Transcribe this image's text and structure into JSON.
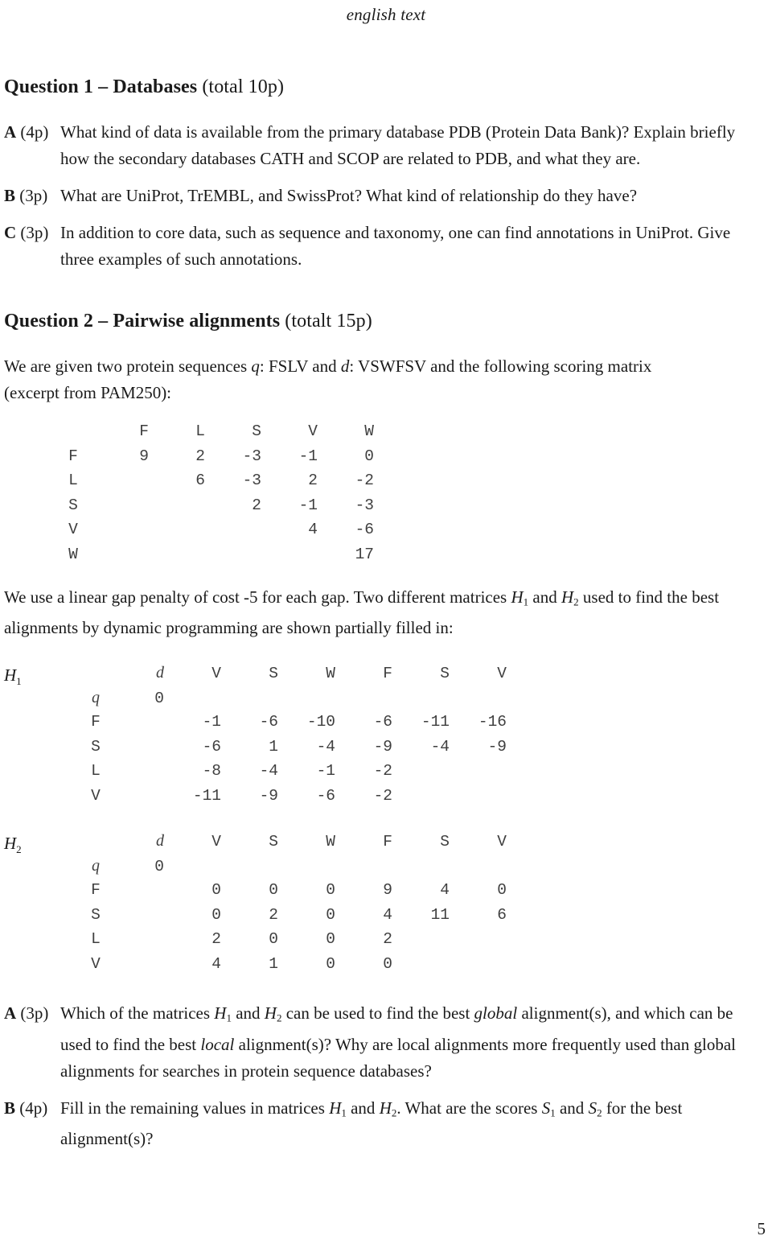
{
  "header": {
    "running_head": "english text"
  },
  "page_number": "5",
  "question1": {
    "heading_bold": "Question 1 – Databases",
    "heading_light": " (total 10p)",
    "items": [
      {
        "letter": "A",
        "points": "(4p)",
        "text": "What kind of data is available from the primary database PDB (Protein Data Bank)? Explain briefly how the secondary databases CATH and SCOP are related to PDB, and what they are."
      },
      {
        "letter": "B",
        "points": "(3p)",
        "text": "What are UniProt, TrEMBL, and SwissProt? What kind of relationship do they have?"
      },
      {
        "letter": "C",
        "points": "(3p)",
        "text": "In addition to core data, such as sequence and taxonomy, one can find annotations in UniProt. Give three examples of such annotations."
      }
    ]
  },
  "question2": {
    "heading_bold": "Question 2 – Pairwise alignments",
    "heading_light": " (totalt 15p)",
    "intro_line1_a": "We are given two protein sequences ",
    "intro_q": "q",
    "intro_line1_b": ": FSLV and ",
    "intro_d": "d",
    "intro_line1_c": ": VSWFSV and the following scoring matrix",
    "intro_line2": "(excerpt from PAM250):",
    "gap_note_a": "We use a linear gap penalty of cost -5 for each gap. Two different matrices ",
    "gap_note_h1": "H",
    "gap_note_h1sub": "1",
    "gap_note_b": " and ",
    "gap_note_h2": "H",
    "gap_note_h2sub": "2",
    "gap_note_c": " used to find the best alignments by dynamic programming are shown partially filled in:",
    "items": [
      {
        "letter": "A",
        "points": "(3p)",
        "text_a": "Which of the matrices ",
        "h1": "H",
        "h1sub": "1",
        "text_b": " and ",
        "h2": "H",
        "h2sub": "2",
        "text_c": " can be used to find the best ",
        "em1": "global",
        "text_d": " alignment(s), and which can be used to find the best ",
        "em2": "local",
        "text_e": " alignment(s)? Why are local alignments more frequently used than global alignments for searches in protein sequence databases?"
      },
      {
        "letter": "B",
        "points": "(4p)",
        "text_a": "Fill in the remaining values in matrices ",
        "h1": "H",
        "h1sub": "1",
        "text_b": " and ",
        "h2": "H",
        "h2sub": "2",
        "text_c": ". What are the scores ",
        "s1": "S",
        "s1sub": "1",
        "text_d": " and ",
        "s2": "S",
        "s2sub": "2",
        "text_e": " for the best alignment(s)?"
      }
    ]
  },
  "chart_data": {
    "type": "table",
    "title": "Scoring matrix excerpt from PAM250 and dynamic programming matrices H1, H2",
    "scoring_matrix": {
      "name": "PAM250 excerpt",
      "columns": [
        "F",
        "L",
        "S",
        "V",
        "W"
      ],
      "rows": [
        {
          "label": "F",
          "values": [
            "9",
            "2",
            "-3",
            "-1",
            "0"
          ]
        },
        {
          "label": "L",
          "values": [
            "",
            "6",
            "-3",
            "2",
            "-2"
          ]
        },
        {
          "label": "S",
          "values": [
            "",
            "",
            "2",
            "-1",
            "-3"
          ]
        },
        {
          "label": "V",
          "values": [
            "",
            "",
            "",
            "4",
            "-6"
          ]
        },
        {
          "label": "W",
          "values": [
            "",
            "",
            "",
            "",
            "17"
          ]
        }
      ]
    },
    "h1": {
      "name": "H",
      "sub": "1",
      "corner_d": "d",
      "columns": [
        "V",
        "S",
        "W",
        "F",
        "S",
        "V"
      ],
      "rows": [
        {
          "label": "q",
          "italic": true,
          "origin": "0",
          "values": [
            "",
            "",
            "",
            "",
            "",
            ""
          ]
        },
        {
          "label": "F",
          "origin": "",
          "values": [
            "-1",
            "-6",
            "-10",
            "-6",
            "-11",
            "-16"
          ]
        },
        {
          "label": "S",
          "origin": "",
          "values": [
            "-6",
            "1",
            "-4",
            "-9",
            "-4",
            "-9"
          ]
        },
        {
          "label": "L",
          "origin": "",
          "values": [
            "-8",
            "-4",
            "-1",
            "-2",
            "",
            ""
          ]
        },
        {
          "label": "V",
          "origin": "",
          "values": [
            "-11",
            "-9",
            "-6",
            "-2",
            "",
            ""
          ]
        }
      ]
    },
    "h2": {
      "name": "H",
      "sub": "2",
      "corner_d": "d",
      "columns": [
        "V",
        "S",
        "W",
        "F",
        "S",
        "V"
      ],
      "rows": [
        {
          "label": "q",
          "italic": true,
          "origin": "0",
          "values": [
            "",
            "",
            "",
            "",
            "",
            ""
          ]
        },
        {
          "label": "F",
          "origin": "",
          "values": [
            "0",
            "0",
            "0",
            "9",
            "4",
            "0"
          ]
        },
        {
          "label": "S",
          "origin": "",
          "values": [
            "0",
            "2",
            "0",
            "4",
            "11",
            "6"
          ]
        },
        {
          "label": "L",
          "origin": "",
          "values": [
            "2",
            "0",
            "0",
            "2",
            "",
            ""
          ]
        },
        {
          "label": "V",
          "origin": "",
          "values": [
            "4",
            "1",
            "0",
            "0",
            "",
            ""
          ]
        }
      ]
    }
  }
}
